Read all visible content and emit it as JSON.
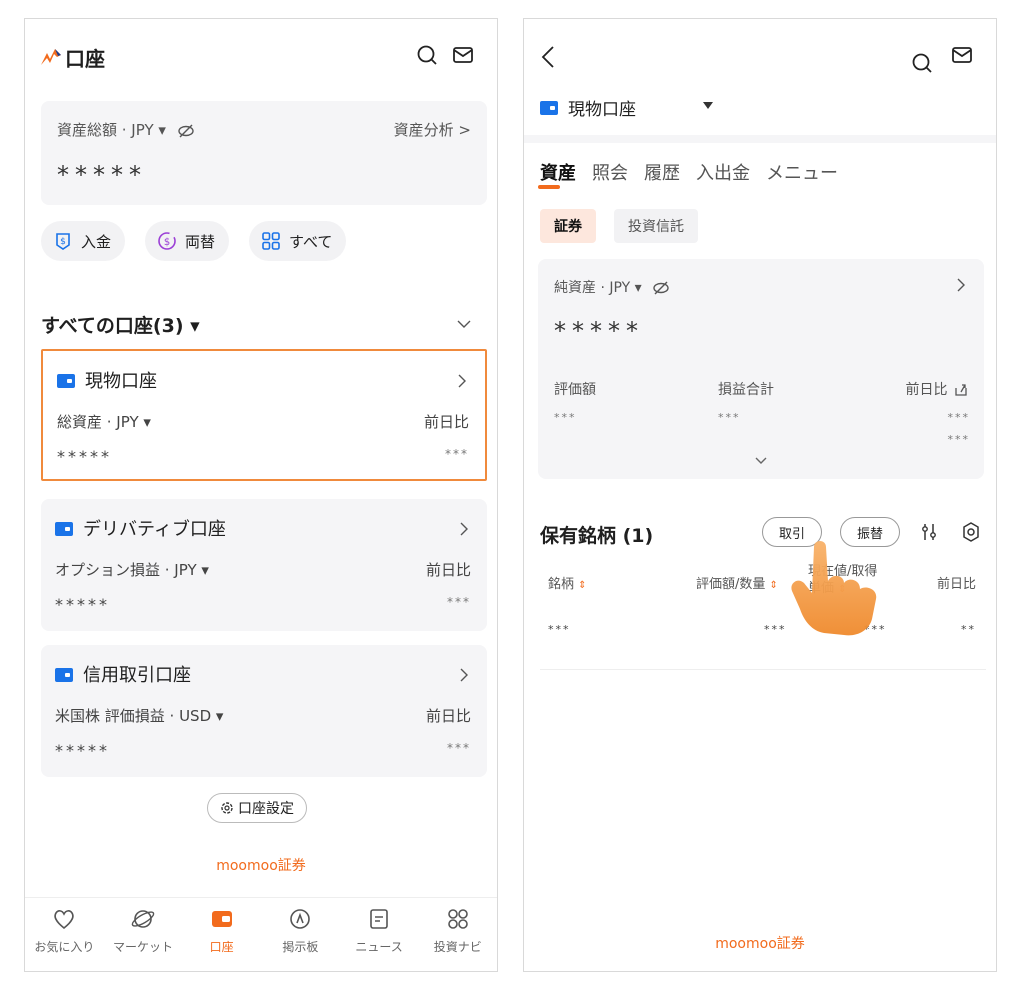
{
  "left": {
    "header": {
      "title": "口座",
      "logo_icon": "bull-logo-icon",
      "search_icon": "search-icon",
      "mail_icon": "mail-icon"
    },
    "asset_card": {
      "label": "資産総額 · JPY ▾",
      "analysis": "資産分析 >",
      "value": "*****"
    },
    "actions": [
      {
        "label": "入金",
        "icon": "deposit-icon"
      },
      {
        "label": "両替",
        "icon": "exchange-icon"
      },
      {
        "label": "すべて",
        "icon": "grid-icon"
      }
    ],
    "all_accounts": {
      "label": "すべての口座(3) ▾"
    },
    "accounts": [
      {
        "name": "現物口座",
        "sub": "総資産 · JPY ▾",
        "compare": "前日比",
        "stars": "*****",
        "stars_right": "***"
      },
      {
        "name": "デリバティブ口座",
        "sub": "オプション損益 · JPY ▾",
        "compare": "前日比",
        "stars": "*****",
        "stars_right": "***"
      },
      {
        "name": "信用取引口座",
        "sub": "米国株 評価損益 · USD ▾",
        "compare": "前日比",
        "stars": "*****",
        "stars_right": "***"
      }
    ],
    "settings_button": "口座設定",
    "brand_footer": "moomoo証券",
    "tabs": [
      {
        "label": "お気に入り",
        "icon": "heart-icon"
      },
      {
        "label": "マーケット",
        "icon": "planet-icon"
      },
      {
        "label": "口座",
        "icon": "wallet-icon"
      },
      {
        "label": "掲示板",
        "icon": "chat-icon"
      },
      {
        "label": "ニュース",
        "icon": "news-icon"
      },
      {
        "label": "投資ナビ",
        "icon": "apps-icon"
      }
    ]
  },
  "right": {
    "header": {
      "back_icon": "back-icon",
      "search_icon": "search-icon",
      "mail_icon": "mail-icon"
    },
    "account_selector": {
      "name": "現物口座"
    },
    "subtabs": [
      "資産",
      "照会",
      "履歴",
      "入出金",
      "メニュー"
    ],
    "chips": [
      "証券",
      "投資信託"
    ],
    "net_card": {
      "label": "純資産 · JPY ▾",
      "value": "*****",
      "cols": [
        "評価額",
        "損益合計",
        "前日比"
      ],
      "vals": [
        "***",
        "***",
        "***",
        "***"
      ]
    },
    "holdings": {
      "title": "保有銘柄 (1)",
      "trade_button": "取引",
      "transfer_button": "振替"
    },
    "table": {
      "headers": [
        "銘柄",
        "評価額/数量",
        "現在値/取得単価",
        "前日比"
      ],
      "row": [
        "***",
        "***",
        "***",
        "**"
      ]
    },
    "brand_footer": "moomoo証券"
  },
  "colors": {
    "accent": "#f26b1d",
    "wallet_blue": "#1a73e8",
    "card_bg": "#f5f5f7"
  }
}
